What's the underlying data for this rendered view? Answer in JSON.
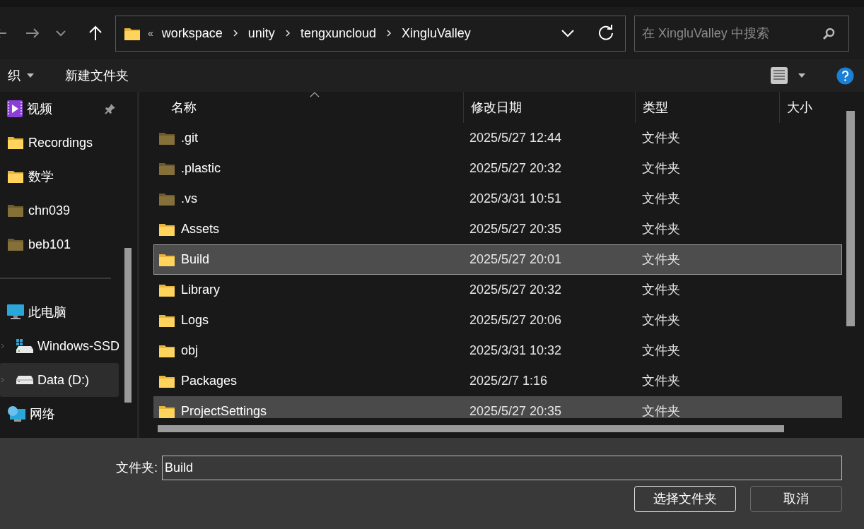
{
  "address_bar": {
    "overflow": "«",
    "path": [
      "workspace",
      "unity",
      "tengxuncloud",
      "XingluValley"
    ]
  },
  "search": {
    "placeholder": "在 XingluValley 中搜索"
  },
  "toolbar": {
    "organize": "织",
    "new_folder": "新建文件夹"
  },
  "sidebar": {
    "items": [
      {
        "label": "视频",
        "kind": "videos",
        "pinned": true,
        "selected": false
      },
      {
        "label": "Recordings",
        "kind": "folder",
        "dim": false,
        "selected": false
      },
      {
        "label": "数学",
        "kind": "folder",
        "dim": false,
        "selected": false
      },
      {
        "label": "chn039",
        "kind": "folder",
        "dim": true,
        "selected": false
      },
      {
        "label": "beb101",
        "kind": "folder",
        "dim": true,
        "selected": false
      },
      {
        "kind": "divider"
      },
      {
        "label": "此电脑",
        "kind": "pc",
        "selected": false
      },
      {
        "label": "Windows-SSD",
        "kind": "system-drive",
        "selected": false
      },
      {
        "label": "Data (D:)",
        "kind": "drive",
        "selected": true
      },
      {
        "label": "网络",
        "kind": "network",
        "selected": false
      }
    ]
  },
  "table": {
    "columns": [
      "名称",
      "修改日期",
      "类型",
      "大小"
    ],
    "rows": [
      {
        "name": ".git",
        "modified": "2025/5/27 12:44",
        "type": "文件夹",
        "dim": true,
        "selected": false,
        "hovered": false
      },
      {
        "name": ".plastic",
        "modified": "2025/5/27 20:32",
        "type": "文件夹",
        "dim": true,
        "selected": false,
        "hovered": false
      },
      {
        "name": ".vs",
        "modified": "2025/3/31 10:51",
        "type": "文件夹",
        "dim": true,
        "selected": false,
        "hovered": false
      },
      {
        "name": "Assets",
        "modified": "2025/5/27 20:35",
        "type": "文件夹",
        "dim": false,
        "selected": false,
        "hovered": false
      },
      {
        "name": "Build",
        "modified": "2025/5/27 20:01",
        "type": "文件夹",
        "dim": false,
        "selected": true,
        "hovered": false
      },
      {
        "name": "Library",
        "modified": "2025/5/27 20:32",
        "type": "文件夹",
        "dim": false,
        "selected": false,
        "hovered": false
      },
      {
        "name": "Logs",
        "modified": "2025/5/27 20:06",
        "type": "文件夹",
        "dim": false,
        "selected": false,
        "hovered": false
      },
      {
        "name": "obj",
        "modified": "2025/3/31 10:32",
        "type": "文件夹",
        "dim": false,
        "selected": false,
        "hovered": false
      },
      {
        "name": "Packages",
        "modified": "2025/2/7 1:16",
        "type": "文件夹",
        "dim": false,
        "selected": false,
        "hovered": false
      },
      {
        "name": "ProjectSettings",
        "modified": "2025/5/27 20:35",
        "type": "文件夹",
        "dim": false,
        "selected": false,
        "hovered": true
      }
    ]
  },
  "folder_field": {
    "label": "文件夹:",
    "value": "Build"
  },
  "buttons": {
    "select": "选择文件夹",
    "cancel": "取消"
  }
}
